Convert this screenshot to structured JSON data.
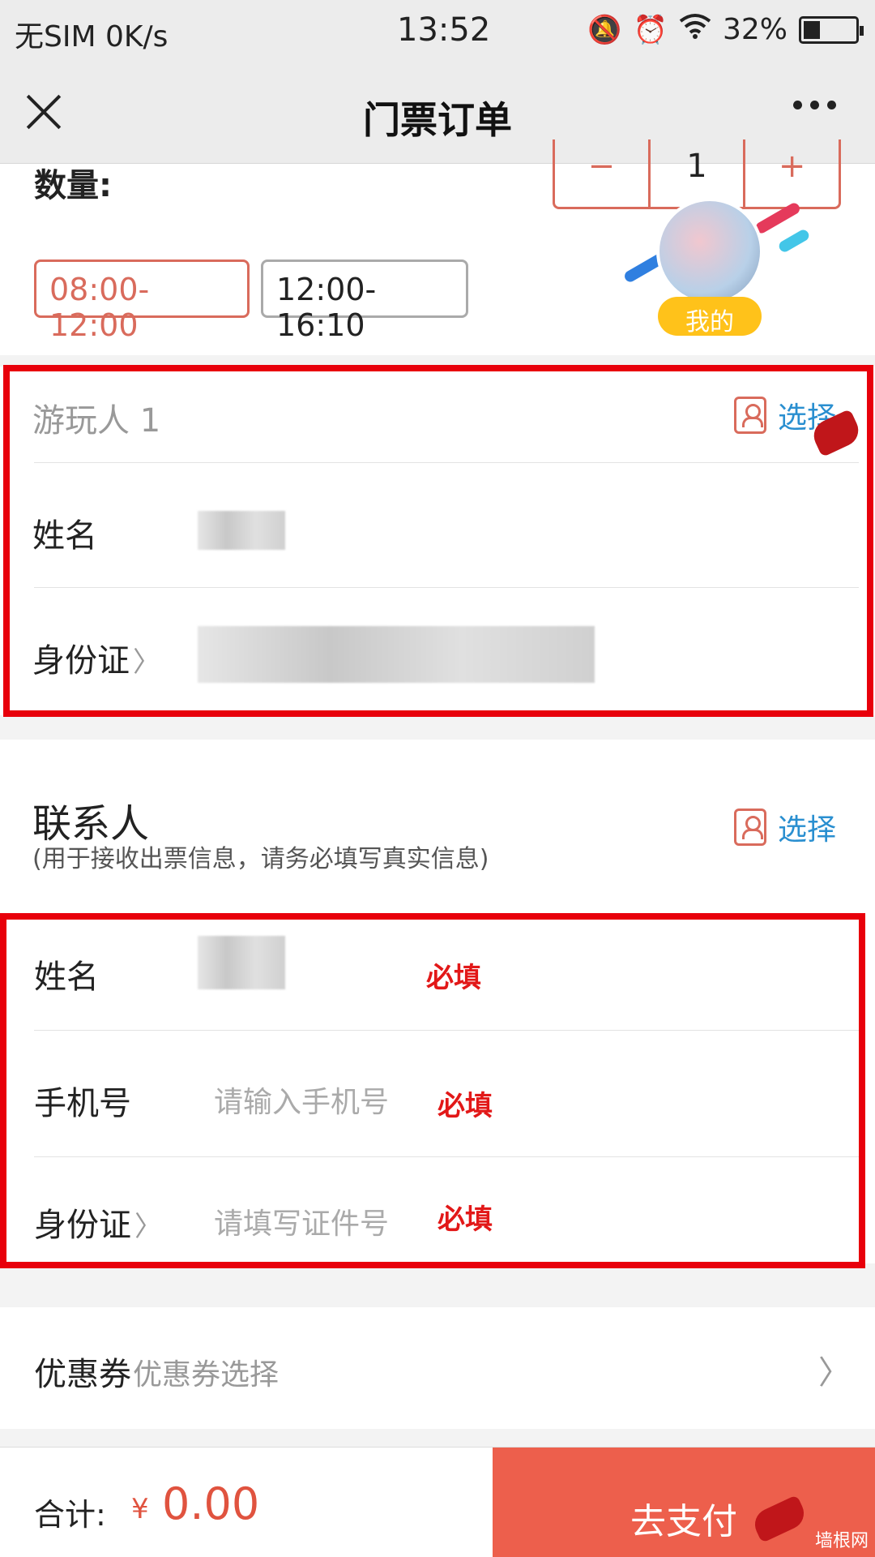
{
  "status_bar": {
    "carrier": "无SIM",
    "speed": "0K/s",
    "time": "13:52",
    "battery": "32%",
    "battery_level": 0.32
  },
  "nav": {
    "title": "门票订单"
  },
  "ticket": {
    "quantity_label": "数量:",
    "quantity_minus": "−",
    "quantity_value": "1",
    "quantity_plus": "+",
    "time_slots": [
      "08:00-12:00",
      "12:00-16:10"
    ],
    "float_badge": "我的"
  },
  "visitor": {
    "header": "游玩人 1",
    "select_label": "选择",
    "name_label": "姓名",
    "id_label": "身份证"
  },
  "contact": {
    "title": "联系人",
    "subtitle": "(用于接收出票信息，请务必填写真实信息)",
    "select_label": "选择",
    "name_label": "姓名",
    "phone_label": "手机号",
    "phone_placeholder": "请输入手机号",
    "id_label": "身份证",
    "id_placeholder": "请填写证件号",
    "required_mark": "必填"
  },
  "coupon": {
    "label": "优惠券",
    "placeholder": "优惠券选择"
  },
  "footer": {
    "total_label": "合计:",
    "currency": "¥",
    "total_value": "0.00",
    "pay_label": "去支付",
    "watermark": "墙根网"
  },
  "colors": {
    "accent": "#d96b5c",
    "link": "#2a8fd0",
    "pay_button": "#ed5f4c",
    "annotation_red": "#e8000b"
  }
}
